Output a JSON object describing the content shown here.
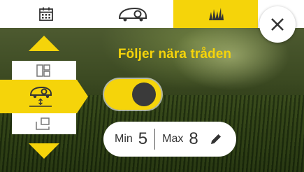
{
  "tabs": [
    {
      "name": "calendar-icon"
    },
    {
      "name": "mower-icon"
    },
    {
      "name": "grass-icon",
      "active": true
    }
  ],
  "close": {
    "icon": "close-icon"
  },
  "side_menu": {
    "up": "arrow-up-icon",
    "down": "arrow-down-icon",
    "items": [
      "layout-grid-icon",
      "mower-follow-wire-icon",
      "layout-corner-icon"
    ],
    "selected_index": 1
  },
  "main": {
    "title": "Följer nära tråden",
    "toggle_on": true,
    "range": {
      "min_label": "Min",
      "min_value": "5",
      "max_label": "Max",
      "max_value": "8",
      "edit_icon": "pencil-icon"
    }
  },
  "colors": {
    "accent": "#f5d40a",
    "dark": "#3a3a3a",
    "white": "#ffffff"
  }
}
